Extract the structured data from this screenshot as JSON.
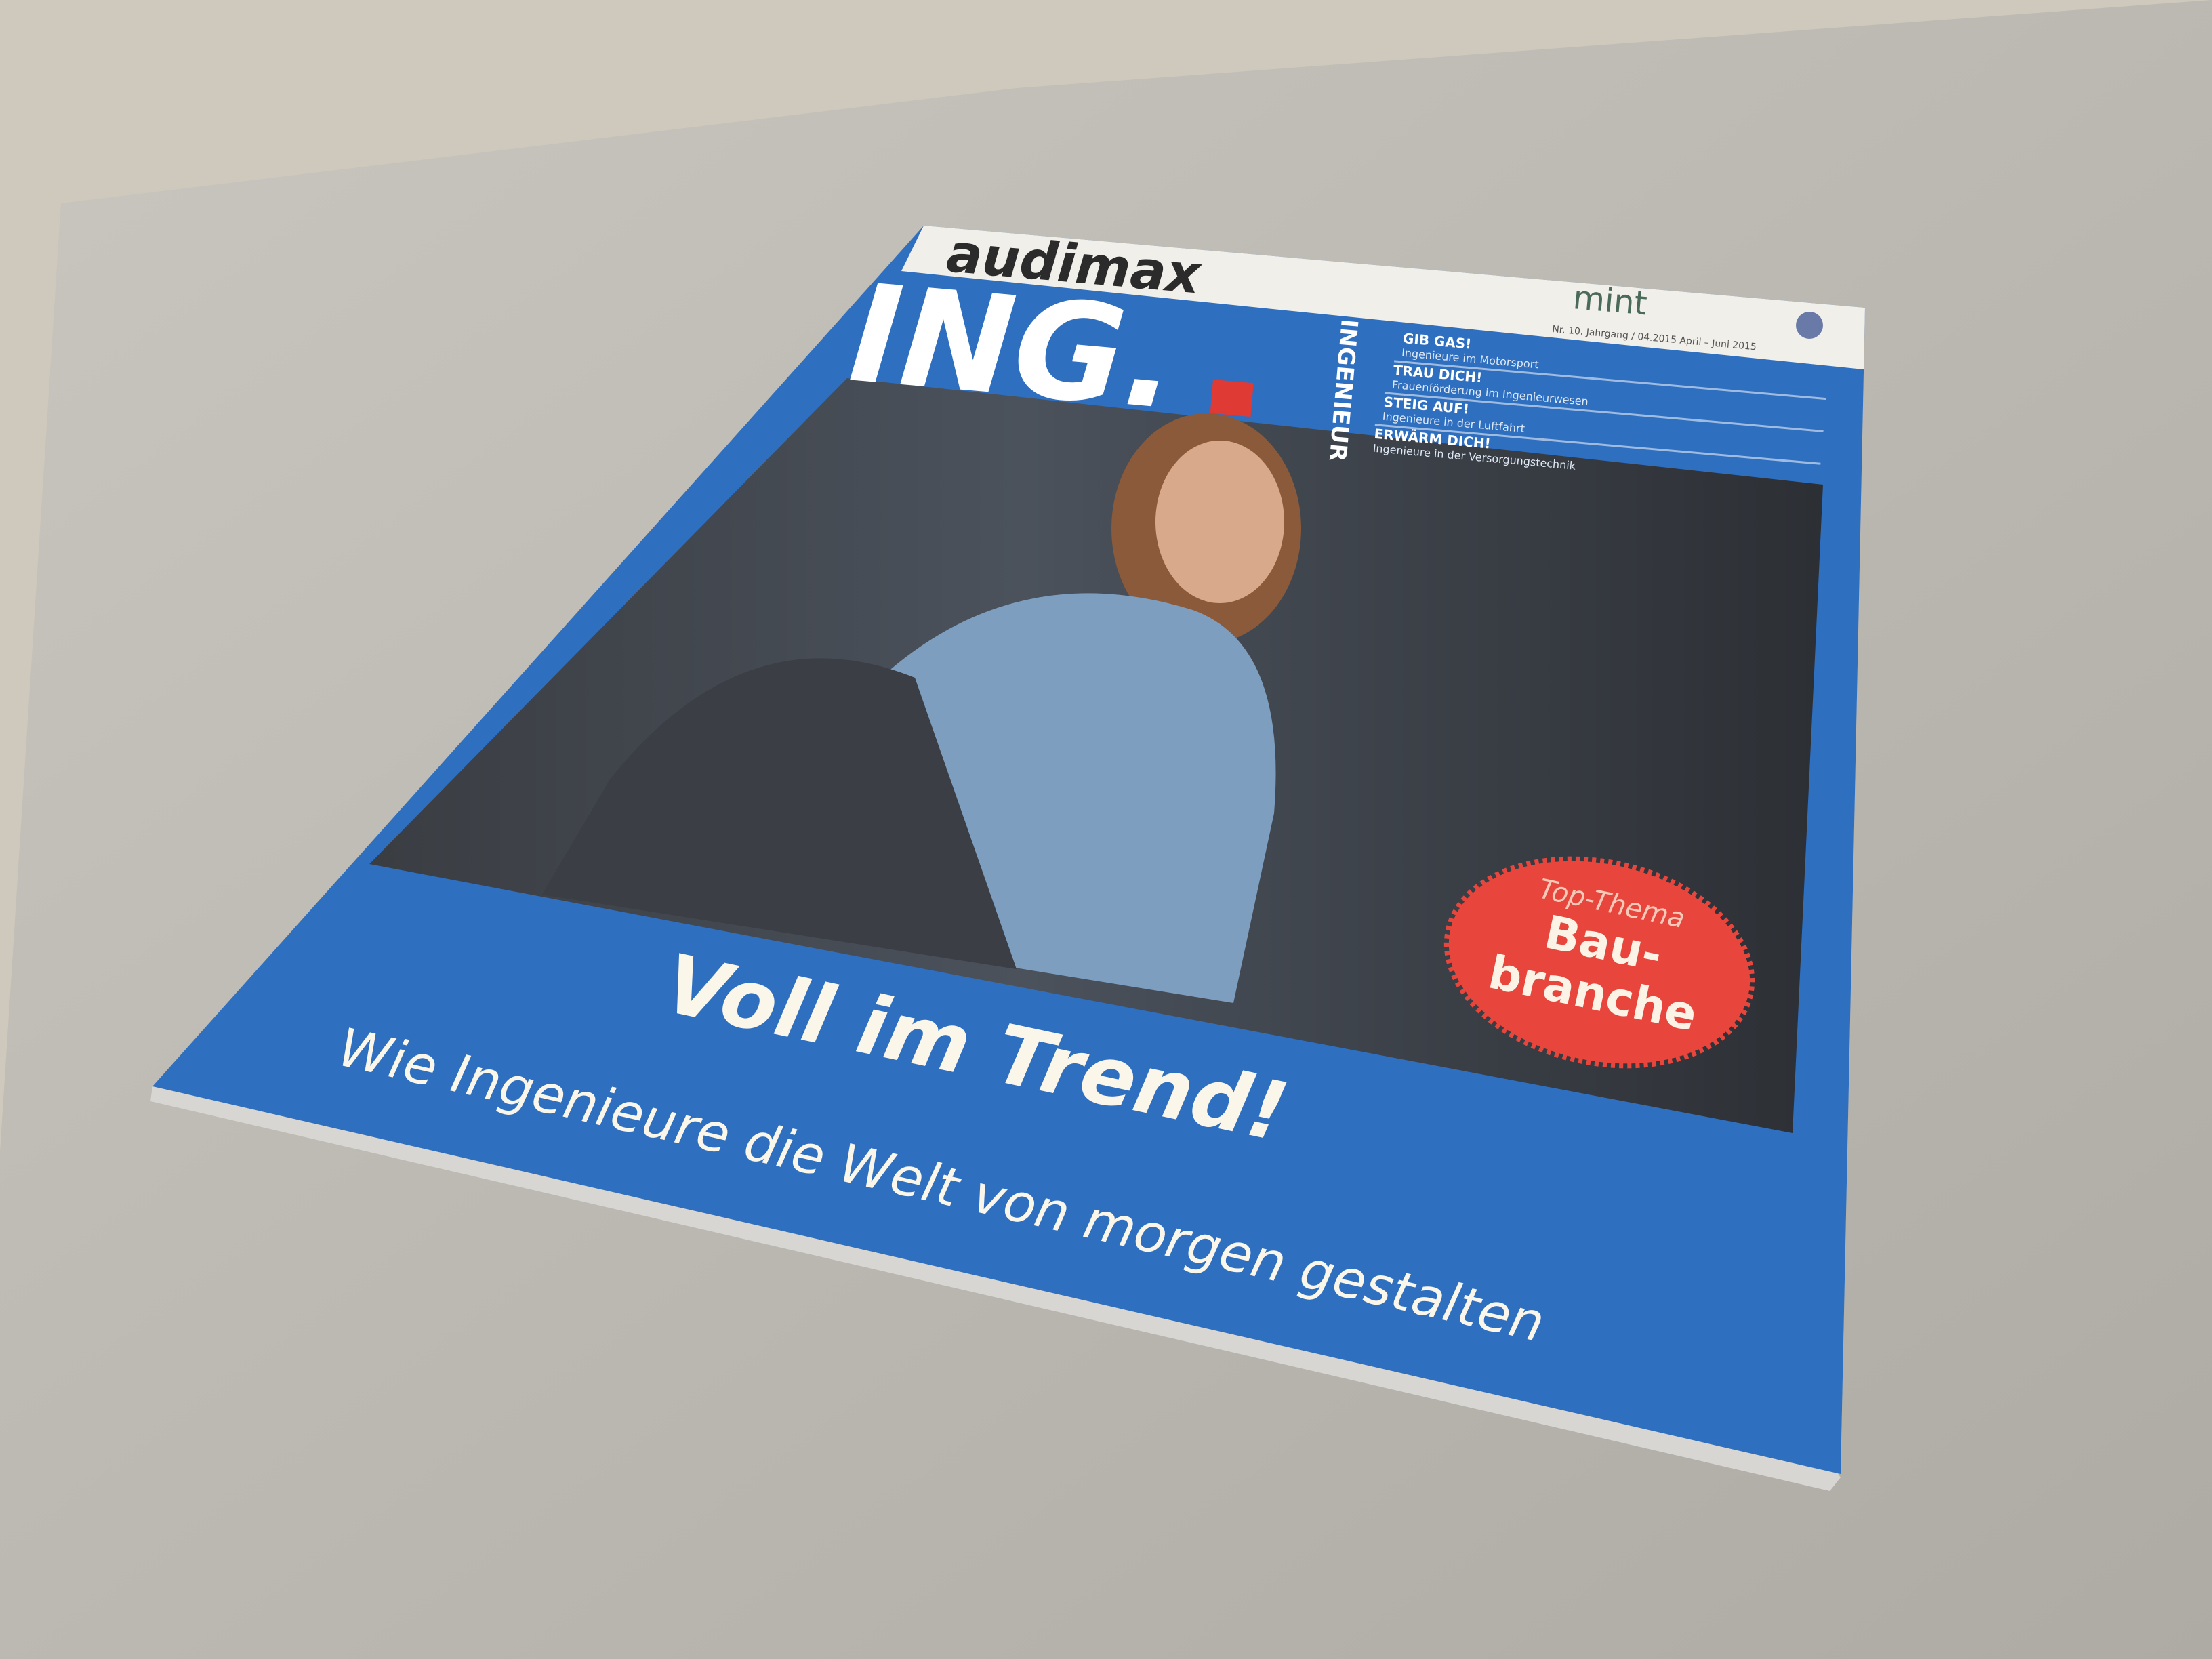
{
  "magazine": {
    "brand": "audimax",
    "title": "ING.",
    "vertical_label": "INGENIEUR",
    "partner_logo": "mint",
    "issue_line": "Nr. 10. Jahrgang / 04.2015 April – Juni 2015",
    "teasers": [
      {
        "title": "GIB GAS!",
        "subtitle": "Ingenieure im Motorsport"
      },
      {
        "title": "TRAU DICH!",
        "subtitle": "Frauenförderung im Ingenieurwesen"
      },
      {
        "title": "STEIG AUF!",
        "subtitle": "Ingenieure in der Luftfahrt"
      },
      {
        "title": "ERWÄRM DICH!",
        "subtitle": "Ingenieure in der Versorgungstechnik"
      }
    ],
    "badge": {
      "kicker": "Top-Thema",
      "line1": "Bau-",
      "line2": "branche"
    },
    "headline": "Voll im Trend!",
    "subheadline": "Wie Ingenieure die Welt von morgen gestalten"
  },
  "colors": {
    "cover_blue": "#2f6fc0",
    "badge_red": "#e8463c",
    "table": "#bdbab3",
    "header_white": "#f1efe9"
  }
}
